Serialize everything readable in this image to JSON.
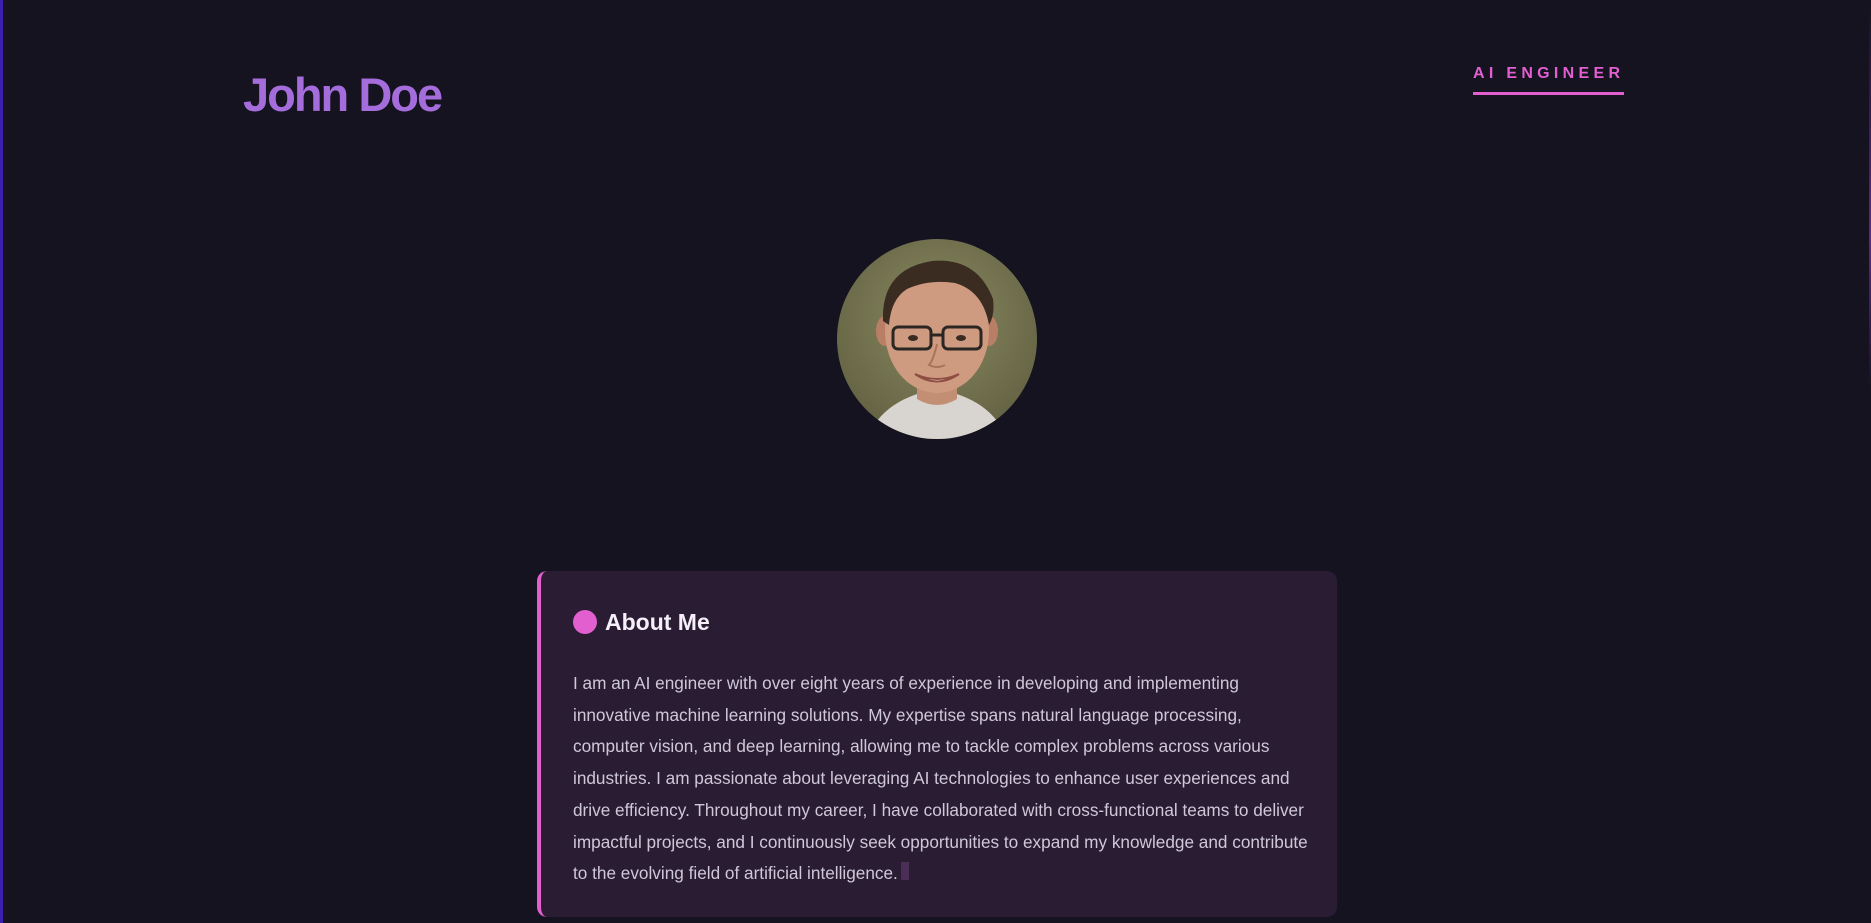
{
  "header": {
    "name": "John Doe",
    "role": "AI ENGINEER"
  },
  "profile": {
    "avatar_alt": "portrait photo"
  },
  "about": {
    "title": "About Me",
    "text": "I am an AI engineer with over eight years of experience in developing and implementing innovative machine learning solutions. My expertise spans natural language processing, computer vision, and deep learning, allowing me to tackle complex problems across various industries. I am passionate about leveraging AI technologies to enhance user experiences and drive efficiency. Throughout my career, I have collaborated with cross-functional teams to deliver impactful projects, and I continuously seek opportunities to expand my knowledge and contribute to the evolving field of artificial intelligence."
  },
  "colors": {
    "background": "#14131f",
    "name_accent": "#a56ddc",
    "pink_accent": "#e25fd0",
    "card_background": "#2a1c33"
  }
}
